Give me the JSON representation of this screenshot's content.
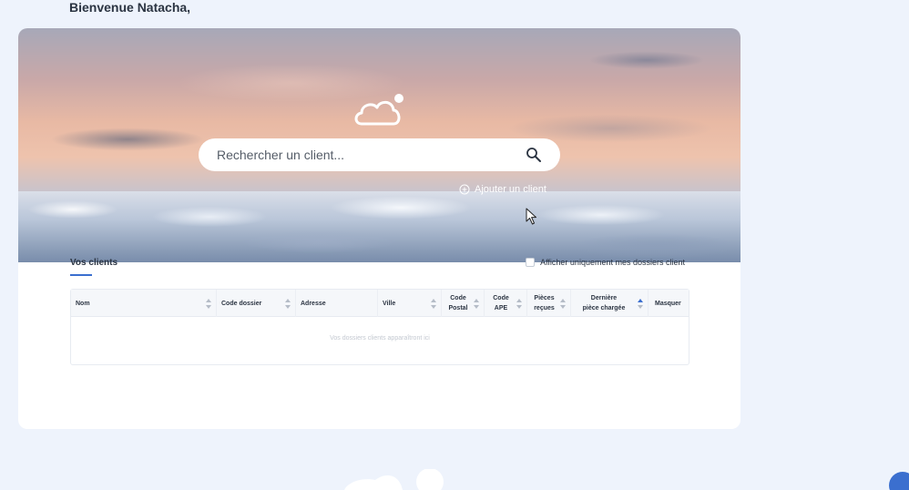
{
  "greeting": "Bienvenue Natacha,",
  "hero": {
    "search_placeholder": "Rechercher un client...",
    "add_client_label": "Ajouter un client"
  },
  "clients": {
    "title": "Vos clients",
    "filter_label": "Afficher uniquement mes dossiers client",
    "filter_checked": false,
    "columns": [
      {
        "line1": "Nom",
        "line2": ""
      },
      {
        "line1": "Code dossier",
        "line2": ""
      },
      {
        "line1": "Adresse",
        "line2": ""
      },
      {
        "line1": "Ville",
        "line2": ""
      },
      {
        "line1": "Code",
        "line2": "Postal"
      },
      {
        "line1": "Code",
        "line2": "APE"
      },
      {
        "line1": "Pièces",
        "line2": "reçues"
      },
      {
        "line1": "Dernière",
        "line2": "pièce chargée"
      },
      {
        "line1": "Masquer",
        "line2": ""
      }
    ],
    "empty_message": "Vos dossiers clients apparaîtront ici"
  },
  "colors": {
    "accent": "#3b6fcf",
    "page_bg": "#eef3fc",
    "text": "#2b3442"
  }
}
